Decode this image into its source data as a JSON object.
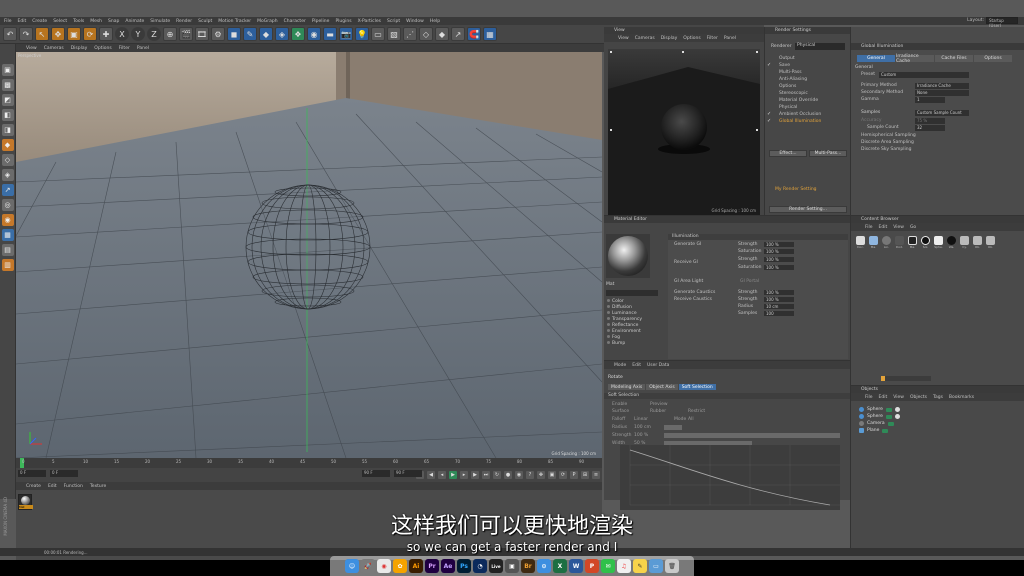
{
  "menubar": {
    "items": [
      "File",
      "Edit",
      "Create",
      "Select",
      "Tools",
      "Mesh",
      "Snap",
      "Animate",
      "Simulate",
      "Render",
      "Sculpt",
      "Motion Tracker",
      "MoGraph",
      "Character",
      "Pipeline",
      "Plugins",
      "X-Particles",
      "Script",
      "Window",
      "Help"
    ],
    "layout_label": "Layout:",
    "layout_value": "Startup (User)"
  },
  "viewport": {
    "menu": [
      "View",
      "Cameras",
      "Display",
      "Options",
      "Filter",
      "Panel"
    ],
    "label": "Perspective",
    "grid_spacing": "Grid Spacing : 100 cm"
  },
  "timeline": {
    "ticks": [
      "0",
      "5",
      "10",
      "15",
      "20",
      "25",
      "30",
      "35",
      "40",
      "45",
      "50",
      "55",
      "60",
      "65",
      "70",
      "75",
      "80",
      "85",
      "90"
    ],
    "start_field": "0 F",
    "current_field": "0 F",
    "end_field": "90 F",
    "end_field2": "90 F"
  },
  "material_manager": {
    "menu": [
      "Create",
      "Edit",
      "Function",
      "Texture"
    ],
    "material_name": "Mat"
  },
  "status": {
    "text": "00:00:01 Rendering..."
  },
  "render_view": {
    "title": "View",
    "menu": [
      "View",
      "Cameras",
      "Display",
      "Options",
      "Filter",
      "Panel"
    ],
    "label": "Perspective",
    "grid_spacing": "Grid Spacing : 100 cm"
  },
  "render_settings": {
    "title": "Render Settings",
    "renderer_label": "Renderer",
    "renderer_value": "Physical",
    "items": [
      {
        "label": "Output",
        "checked": false
      },
      {
        "label": "Save",
        "checked": true
      },
      {
        "label": "Multi-Pass",
        "checked": false
      },
      {
        "label": "Anti-Aliasing",
        "checked": false
      },
      {
        "label": "Options",
        "checked": false
      },
      {
        "label": "Stereoscopic",
        "checked": false
      },
      {
        "label": "Material Override",
        "checked": false
      },
      {
        "label": "Physical",
        "checked": false
      },
      {
        "label": "Ambient Occlusion",
        "checked": true
      },
      {
        "label": "Global Illumination",
        "checked": true
      }
    ],
    "effect_button": "Effect...",
    "multipass_button": "Multi-Pass...",
    "my_setting": "My Render Setting",
    "render_setting_button": "Render Setting..."
  },
  "global_illumination": {
    "title": "Global Illumination",
    "tabs": [
      "General",
      "Irradiance Cache",
      "Cache Files",
      "Options"
    ],
    "section_general": "General",
    "preset_label": "Preset",
    "preset_value": "Custom",
    "primary_label": "Primary Method",
    "primary_value": "Irradiance Cache",
    "secondary_label": "Secondary Method",
    "secondary_value": "None",
    "gamma_label": "Gamma",
    "gamma_value": "1",
    "section_samples": "Samples",
    "samples_value": "Custom Sample Count",
    "accuracy_label": "Accuracy",
    "accuracy_value": "75 %",
    "sample_count_label": "Sample Count",
    "sample_count_value": "32",
    "hemi_label": "Hemispherical Sampling",
    "discrete_area_label": "Discrete Area Sampling",
    "discrete_sky_label": "Discrete Sky Sampling"
  },
  "material_editor": {
    "title": "Material Editor",
    "name": "Mat",
    "channels": [
      "Color",
      "Diffusion",
      "Luminance",
      "Transparency",
      "Reflectance",
      "Environment",
      "Fog",
      "Bump"
    ],
    "header": "Illumination",
    "gen_gi": "Generate GI",
    "receive_gi": "Receive GI",
    "gi_area_light": "GI Area Light",
    "gi_portal": "GI Portal",
    "gen_caustics": "Generate Caustics",
    "receive_caustics": "Receive Caustics",
    "strength_label": "Strength",
    "saturation_label": "Saturation",
    "radius_label": "Radius",
    "samples_label": "Samples",
    "strength_value": "100 %",
    "saturation_value": "100 %",
    "radius_value": "10 cm",
    "samples_value": "100"
  },
  "content_browser": {
    "title": "Content Browser",
    "menu": [
      "File",
      "Edit",
      "View",
      "Go"
    ],
    "items": [
      "Doc.",
      "Ma.",
      "Lin.",
      "Dod.",
      "Me.",
      "Sol.",
      "Sphe.",
      "Wa.",
      "Cy.",
      "Ob.",
      "Ob."
    ]
  },
  "attributes": {
    "menu": [
      "Mode",
      "Edit",
      "User Data"
    ],
    "object_name": "Rotate",
    "tabs": [
      "Modeling Axis",
      "Object Axis",
      "Soft Selection"
    ],
    "section": "Soft Selection",
    "rows": [
      "Enable",
      "Surface",
      "Falloff",
      "Radius",
      "Strength",
      "Width"
    ],
    "preview_label": "Preview",
    "rubber_label": "Rubber",
    "restrict_label": "Restrict",
    "falloff_value": "Linear",
    "mode_label": "Mode",
    "mode_value": "All",
    "radius_value": "100 cm",
    "strength_value": "100 %",
    "width_value": "50 %"
  },
  "objects": {
    "title": "Objects",
    "menu": [
      "File",
      "Edit",
      "View",
      "Objects",
      "Tags",
      "Bookmarks"
    ],
    "rows": [
      "Sphere",
      "Sphere",
      "Camera",
      "Plane"
    ]
  },
  "subtitles": {
    "chinese": "这样我们可以更快地渲染",
    "english": "so we can get a faster render and I"
  },
  "dock": {
    "apps": [
      "Finder",
      "Launchpad",
      "Chrome",
      "Photos",
      "Ai",
      "Pr",
      "Ae",
      "Ps",
      "Cinema 4D",
      "Live",
      "App",
      "Bridge",
      "Safari",
      "Excel",
      "Word",
      "PowerPoint",
      "Messages",
      "Music",
      "Notes",
      "Finder2",
      "Trash"
    ]
  },
  "colors": {
    "accent": "#3f6fa6",
    "orange": "#e3a33a",
    "green": "#2f8a58"
  }
}
